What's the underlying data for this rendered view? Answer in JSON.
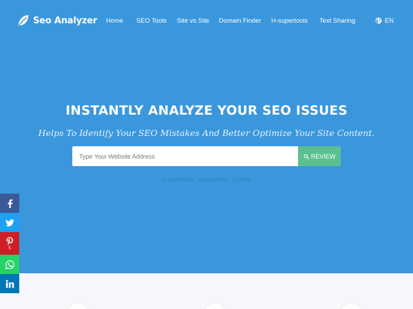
{
  "brand": {
    "name": "Seo Analyzer",
    "icon": "leaf-icon"
  },
  "nav": {
    "items": [
      {
        "label": "Home"
      },
      {
        "label": "SEO Tools"
      },
      {
        "label": "Site vs Site"
      },
      {
        "label": "Domain Finder"
      },
      {
        "label": "H-supertools"
      },
      {
        "label": "Text Sharing"
      }
    ],
    "language": {
      "label": "EN",
      "icon": "globe-icon"
    }
  },
  "hero": {
    "title": "INSTANTLY ANALYZE YOUR SEO ISSUES",
    "subtitle": "Helps To Identify Your SEO Mistakes And Better Optimize Your Site Content.",
    "search": {
      "placeholder": "Type Your Website Address",
      "value": "",
      "button_label": "REVIEW",
      "button_icon": "search-icon"
    },
    "partner_links": [
      "H-supertools",
      "Hijackstricks",
      "Linkme"
    ]
  },
  "share": {
    "pinterest_count": "5",
    "buttons": [
      "facebook-icon",
      "twitter-icon",
      "pinterest-icon",
      "whatsapp-icon",
      "linkedin-icon"
    ]
  },
  "colors": {
    "hero_bg": "#3a97dc",
    "review_button": "#5cbf8f",
    "facebook": "#3b5998",
    "twitter": "#1da1f2",
    "pinterest": "#cb2027",
    "whatsapp": "#25d366",
    "linkedin": "#0077b5"
  }
}
